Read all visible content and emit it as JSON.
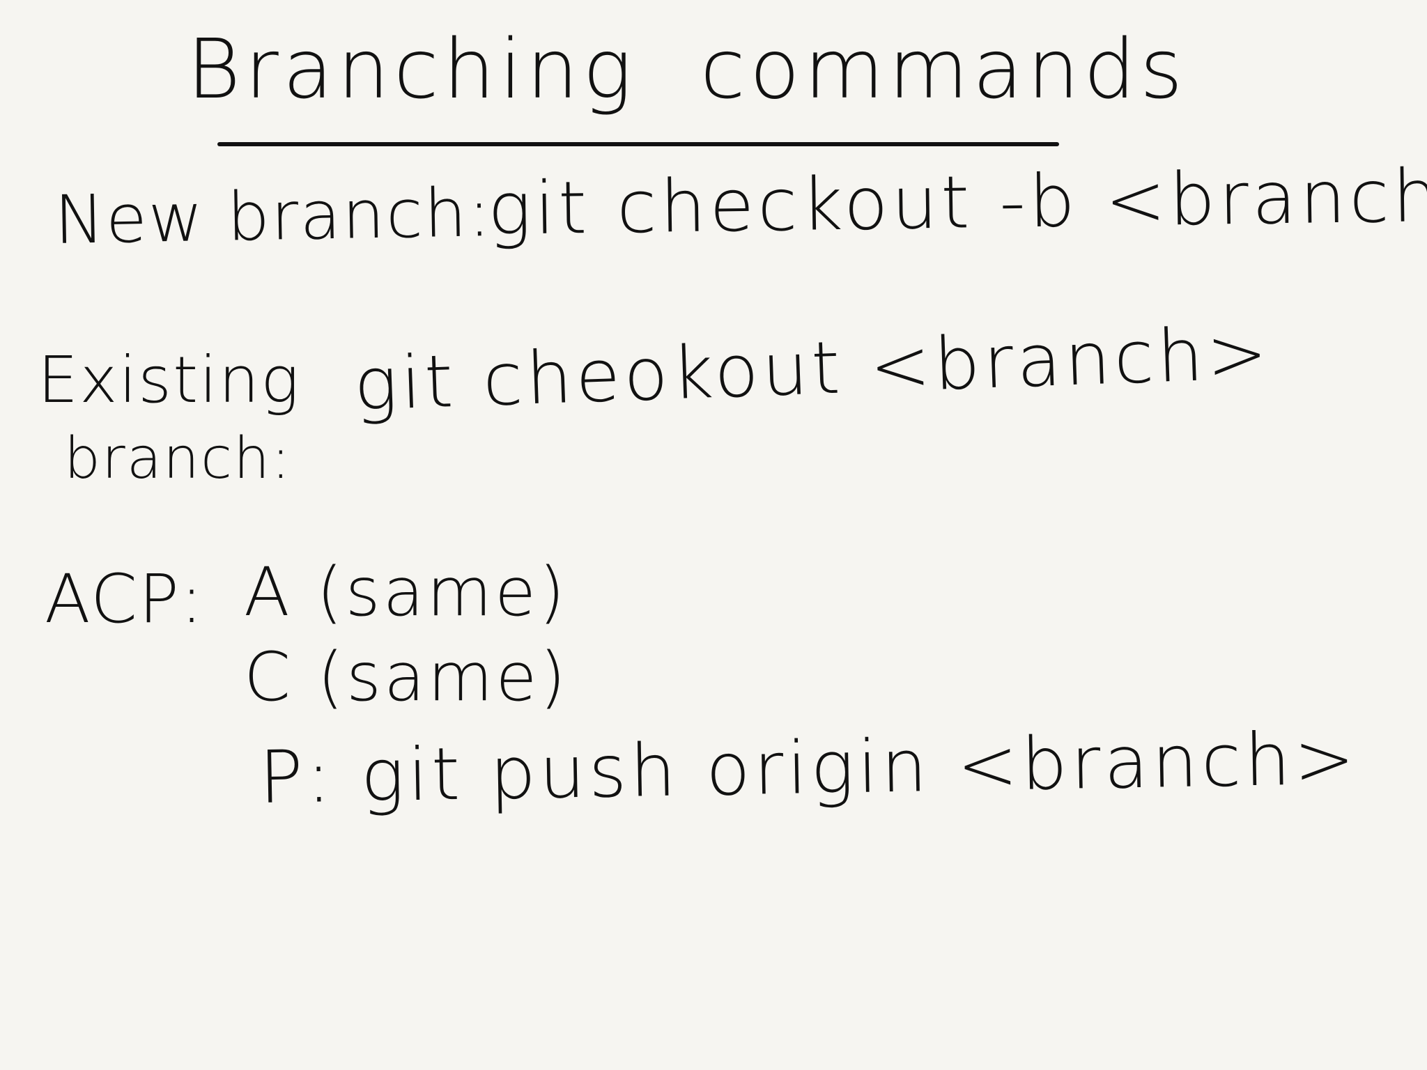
{
  "note": {
    "title_left": "Branching",
    "title_right": "commands",
    "new_branch": {
      "label": "New branch:",
      "command": "git checkout  -b  <branch>"
    },
    "existing_branch": {
      "label_line1": "Existing",
      "label_line2": "branch:",
      "command": "git cheokout  <branch>"
    },
    "acp": {
      "label": "ACP:",
      "a_line": "A (same)",
      "c_line": "C  (same)",
      "p_line": "P: git push origin <branch>"
    }
  },
  "colors": {
    "ink": "#111111",
    "paper": "#f6f5f1"
  }
}
